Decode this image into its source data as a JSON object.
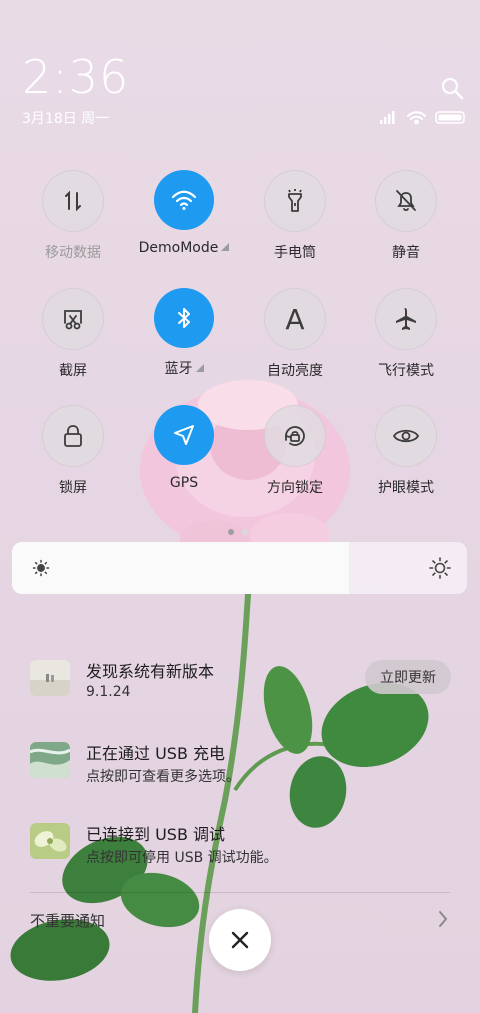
{
  "status": {
    "time": "2:36",
    "date": "3月18日 周一"
  },
  "toggles": [
    {
      "label": "移动数据",
      "icon": "mobile-data-icon",
      "active": false
    },
    {
      "label": "DemoMode",
      "icon": "wifi-icon",
      "active": true
    },
    {
      "label": "手电筒",
      "icon": "flashlight-icon",
      "active": false
    },
    {
      "label": "静音",
      "icon": "mute-bell-icon",
      "active": false
    },
    {
      "label": "截屏",
      "icon": "screenshot-icon",
      "active": false
    },
    {
      "label": "蓝牙",
      "icon": "bluetooth-icon",
      "active": true
    },
    {
      "label": "自动亮度",
      "icon": "auto-brightness-icon",
      "active": false
    },
    {
      "label": "飞行模式",
      "icon": "airplane-icon",
      "active": false
    },
    {
      "label": "锁屏",
      "icon": "lock-icon",
      "active": false
    },
    {
      "label": "GPS",
      "icon": "gps-icon",
      "active": true
    },
    {
      "label": "方向锁定",
      "icon": "rotation-lock-icon",
      "active": false
    },
    {
      "label": "护眼模式",
      "icon": "eye-icon",
      "active": false
    }
  ],
  "auto_brightness_letter": "A",
  "brightness": {
    "level": 0.74
  },
  "notifications": [
    {
      "title": "发现系统有新版本",
      "subtitle": "9.1.24",
      "action": "立即更新"
    },
    {
      "title": "正在通过 USB 充电",
      "subtitle": "点按即可查看更多选项。"
    },
    {
      "title": "已连接到 USB 调试",
      "subtitle": "点按即可停用 USB 调试功能。"
    }
  ],
  "unimportant_label": "不重要通知",
  "colors": {
    "accent": "#1e9bf0"
  }
}
